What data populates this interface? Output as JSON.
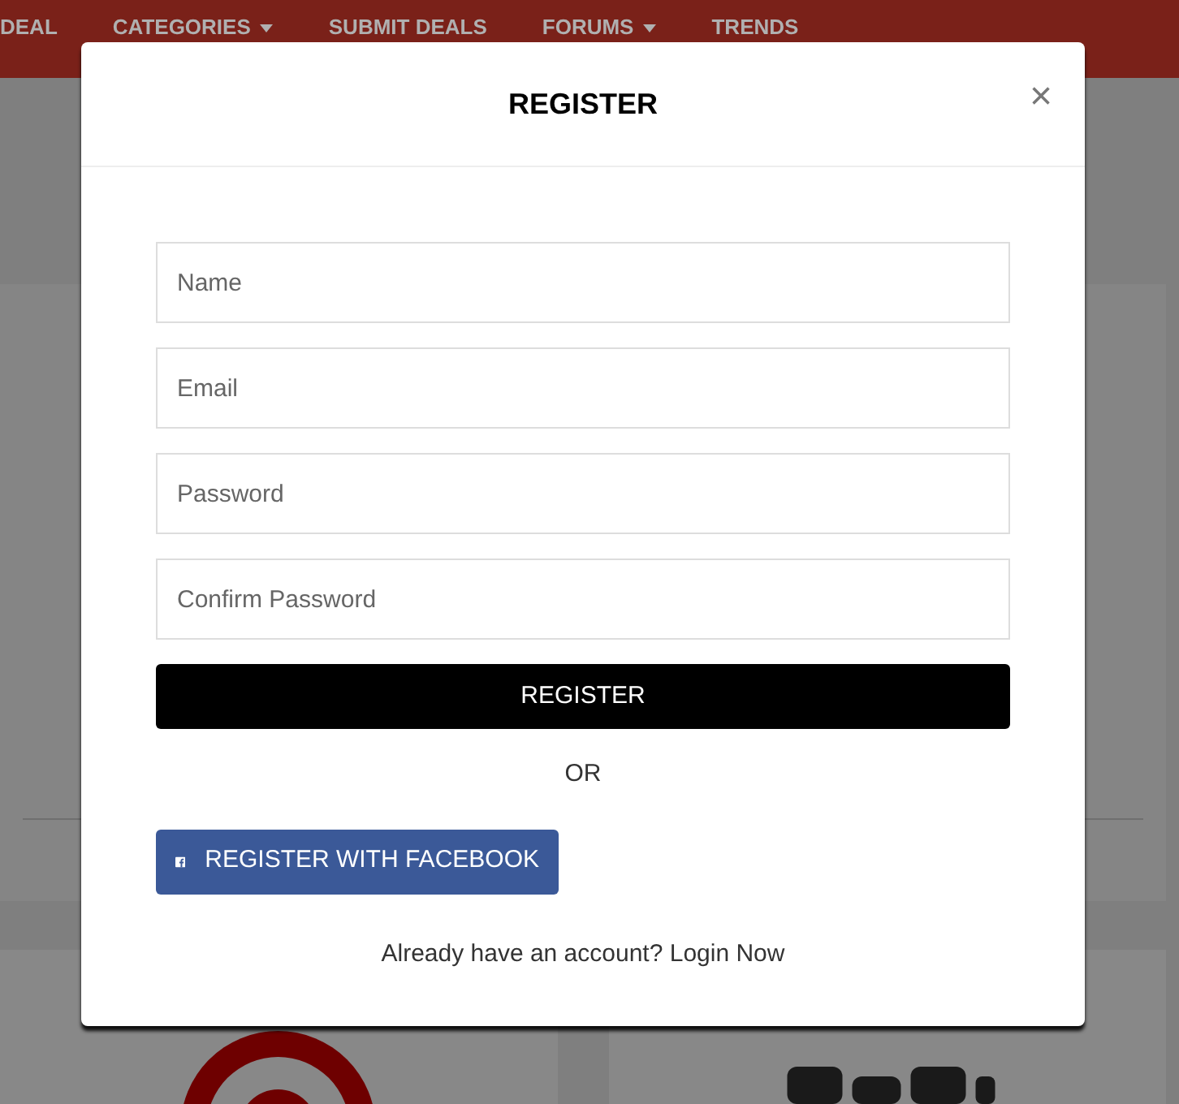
{
  "nav": {
    "items": [
      {
        "label": "DEAL",
        "dropdown": false
      },
      {
        "label": "CATEGORIES",
        "dropdown": true
      },
      {
        "label": "SUBMIT DEALS",
        "dropdown": false
      },
      {
        "label": "FORUMS",
        "dropdown": true
      },
      {
        "label": "TRENDS",
        "dropdown": false
      }
    ]
  },
  "modal": {
    "title": "REGISTER",
    "close": "×",
    "fields": [
      {
        "placeholder": "Name"
      },
      {
        "placeholder": "Email"
      },
      {
        "placeholder": "Password"
      },
      {
        "placeholder": "Confirm Password"
      }
    ],
    "submit": "REGISTER",
    "divider": "OR",
    "facebook_button": "REGISTER WITH FACEBOOK",
    "footer": {
      "text": "Already have an account?",
      "link": "Login Now"
    }
  }
}
